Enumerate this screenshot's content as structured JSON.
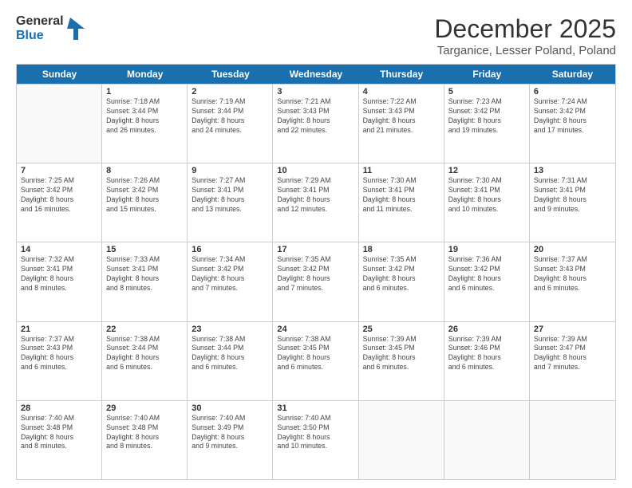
{
  "logo": {
    "line1": "General",
    "line2": "Blue"
  },
  "title": "December 2025",
  "location": "Targanice, Lesser Poland, Poland",
  "header_days": [
    "Sunday",
    "Monday",
    "Tuesday",
    "Wednesday",
    "Thursday",
    "Friday",
    "Saturday"
  ],
  "weeks": [
    [
      {
        "day": "",
        "info": ""
      },
      {
        "day": "1",
        "info": "Sunrise: 7:18 AM\nSunset: 3:44 PM\nDaylight: 8 hours\nand 26 minutes."
      },
      {
        "day": "2",
        "info": "Sunrise: 7:19 AM\nSunset: 3:44 PM\nDaylight: 8 hours\nand 24 minutes."
      },
      {
        "day": "3",
        "info": "Sunrise: 7:21 AM\nSunset: 3:43 PM\nDaylight: 8 hours\nand 22 minutes."
      },
      {
        "day": "4",
        "info": "Sunrise: 7:22 AM\nSunset: 3:43 PM\nDaylight: 8 hours\nand 21 minutes."
      },
      {
        "day": "5",
        "info": "Sunrise: 7:23 AM\nSunset: 3:42 PM\nDaylight: 8 hours\nand 19 minutes."
      },
      {
        "day": "6",
        "info": "Sunrise: 7:24 AM\nSunset: 3:42 PM\nDaylight: 8 hours\nand 17 minutes."
      }
    ],
    [
      {
        "day": "7",
        "info": "Sunrise: 7:25 AM\nSunset: 3:42 PM\nDaylight: 8 hours\nand 16 minutes."
      },
      {
        "day": "8",
        "info": "Sunrise: 7:26 AM\nSunset: 3:42 PM\nDaylight: 8 hours\nand 15 minutes."
      },
      {
        "day": "9",
        "info": "Sunrise: 7:27 AM\nSunset: 3:41 PM\nDaylight: 8 hours\nand 13 minutes."
      },
      {
        "day": "10",
        "info": "Sunrise: 7:29 AM\nSunset: 3:41 PM\nDaylight: 8 hours\nand 12 minutes."
      },
      {
        "day": "11",
        "info": "Sunrise: 7:30 AM\nSunset: 3:41 PM\nDaylight: 8 hours\nand 11 minutes."
      },
      {
        "day": "12",
        "info": "Sunrise: 7:30 AM\nSunset: 3:41 PM\nDaylight: 8 hours\nand 10 minutes."
      },
      {
        "day": "13",
        "info": "Sunrise: 7:31 AM\nSunset: 3:41 PM\nDaylight: 8 hours\nand 9 minutes."
      }
    ],
    [
      {
        "day": "14",
        "info": "Sunrise: 7:32 AM\nSunset: 3:41 PM\nDaylight: 8 hours\nand 8 minutes."
      },
      {
        "day": "15",
        "info": "Sunrise: 7:33 AM\nSunset: 3:41 PM\nDaylight: 8 hours\nand 8 minutes."
      },
      {
        "day": "16",
        "info": "Sunrise: 7:34 AM\nSunset: 3:42 PM\nDaylight: 8 hours\nand 7 minutes."
      },
      {
        "day": "17",
        "info": "Sunrise: 7:35 AM\nSunset: 3:42 PM\nDaylight: 8 hours\nand 7 minutes."
      },
      {
        "day": "18",
        "info": "Sunrise: 7:35 AM\nSunset: 3:42 PM\nDaylight: 8 hours\nand 6 minutes."
      },
      {
        "day": "19",
        "info": "Sunrise: 7:36 AM\nSunset: 3:42 PM\nDaylight: 8 hours\nand 6 minutes."
      },
      {
        "day": "20",
        "info": "Sunrise: 7:37 AM\nSunset: 3:43 PM\nDaylight: 8 hours\nand 6 minutes."
      }
    ],
    [
      {
        "day": "21",
        "info": "Sunrise: 7:37 AM\nSunset: 3:43 PM\nDaylight: 8 hours\nand 6 minutes."
      },
      {
        "day": "22",
        "info": "Sunrise: 7:38 AM\nSunset: 3:44 PM\nDaylight: 8 hours\nand 6 minutes."
      },
      {
        "day": "23",
        "info": "Sunrise: 7:38 AM\nSunset: 3:44 PM\nDaylight: 8 hours\nand 6 minutes."
      },
      {
        "day": "24",
        "info": "Sunrise: 7:38 AM\nSunset: 3:45 PM\nDaylight: 8 hours\nand 6 minutes."
      },
      {
        "day": "25",
        "info": "Sunrise: 7:39 AM\nSunset: 3:45 PM\nDaylight: 8 hours\nand 6 minutes."
      },
      {
        "day": "26",
        "info": "Sunrise: 7:39 AM\nSunset: 3:46 PM\nDaylight: 8 hours\nand 6 minutes."
      },
      {
        "day": "27",
        "info": "Sunrise: 7:39 AM\nSunset: 3:47 PM\nDaylight: 8 hours\nand 7 minutes."
      }
    ],
    [
      {
        "day": "28",
        "info": "Sunrise: 7:40 AM\nSunset: 3:48 PM\nDaylight: 8 hours\nand 8 minutes."
      },
      {
        "day": "29",
        "info": "Sunrise: 7:40 AM\nSunset: 3:48 PM\nDaylight: 8 hours\nand 8 minutes."
      },
      {
        "day": "30",
        "info": "Sunrise: 7:40 AM\nSunset: 3:49 PM\nDaylight: 8 hours\nand 9 minutes."
      },
      {
        "day": "31",
        "info": "Sunrise: 7:40 AM\nSunset: 3:50 PM\nDaylight: 8 hours\nand 10 minutes."
      },
      {
        "day": "",
        "info": ""
      },
      {
        "day": "",
        "info": ""
      },
      {
        "day": "",
        "info": ""
      }
    ]
  ]
}
